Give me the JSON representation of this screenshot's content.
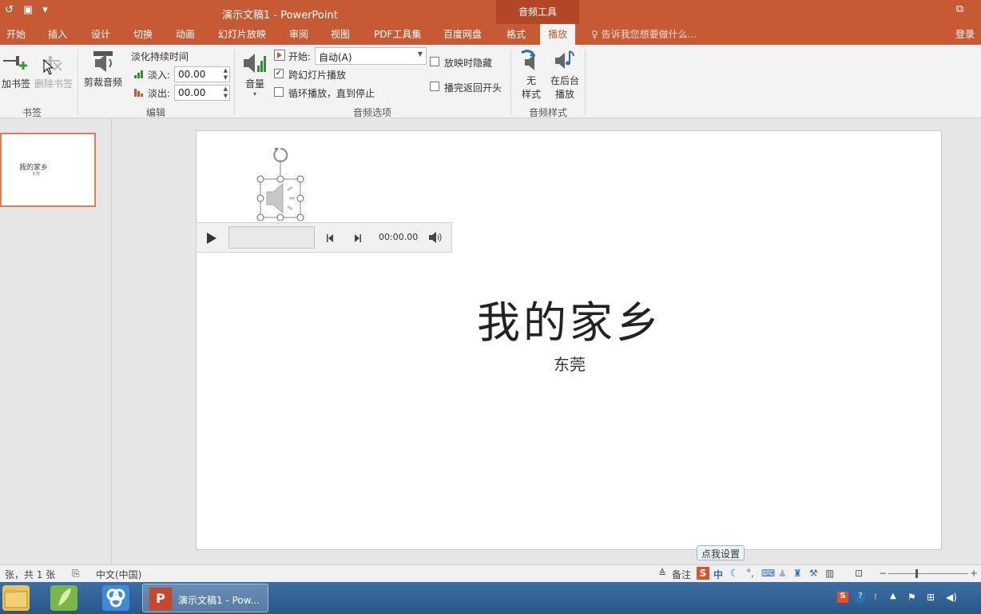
{
  "app": {
    "title": "演示文稿1 - PowerPoint",
    "context_tab_group": "音频工具",
    "login": "登录",
    "tell_me": "告诉我您想要做什么..."
  },
  "tabs": [
    {
      "label": "开始"
    },
    {
      "label": "插入"
    },
    {
      "label": "设计"
    },
    {
      "label": "切换"
    },
    {
      "label": "动画"
    },
    {
      "label": "幻灯片放映"
    },
    {
      "label": "审阅"
    },
    {
      "label": "视图"
    },
    {
      "label": "PDF工具集"
    },
    {
      "label": "百度网盘"
    },
    {
      "label": "格式"
    },
    {
      "label": "播放"
    }
  ],
  "ribbon": {
    "bookmarks": {
      "add": "加书签",
      "remove": "删除书签",
      "group": "书签"
    },
    "editing": {
      "trim": "剪裁音频",
      "fade_title": "淡化持续时间",
      "fade_in_label": "淡入:",
      "fade_in_value": "00.00",
      "fade_out_label": "淡出:",
      "fade_out_value": "00.00",
      "group": "编辑"
    },
    "audio_options": {
      "volume": "音量",
      "start_label": "开始:",
      "start_value": "自动(A)",
      "play_across": "跨幻灯片播放",
      "play_across_checked": true,
      "loop": "循环播放，直到停止",
      "hide": "放映时隐藏",
      "rewind": "播完返回开头",
      "group": "音频选项"
    },
    "audio_styles": {
      "no_style_1": "无",
      "no_style_2": "样式",
      "bg_play_1": "在后台",
      "bg_play_2": "播放",
      "group": "音频样式"
    }
  },
  "thumbnail": {
    "title": "我的家乡",
    "subtitle": "东莞"
  },
  "slide": {
    "title": "我的家乡",
    "subtitle": "东莞"
  },
  "player": {
    "time": "00:00.00"
  },
  "status": {
    "slide_count": "张，共 1 张",
    "language": "中文(中国)",
    "notes": "备注",
    "tooltip": "点我设置",
    "ime_mode": "中"
  },
  "taskbar": {
    "active_window": "演示文稿1 - Pow..."
  },
  "colors": {
    "accent": "#c55a35",
    "context_tab": "#b34626",
    "taskbar": "#2a5688"
  }
}
